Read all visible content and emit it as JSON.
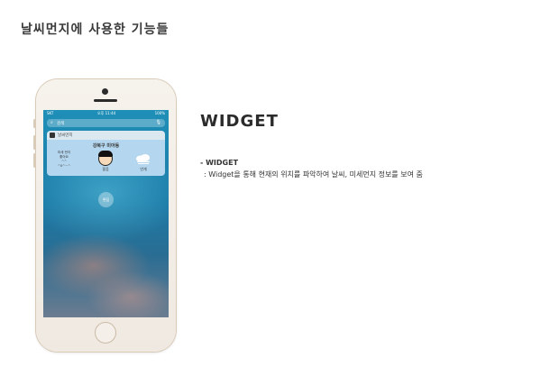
{
  "slide": {
    "title": "날씨먼지에 사용한 기능들"
  },
  "phone": {
    "status": {
      "carrier": "SKT",
      "time": "오후 11:44",
      "battery": "100%"
    },
    "search": {
      "placeholder": "검색"
    },
    "widget": {
      "app_name": "날씨먼지",
      "location": "강북구 미아동",
      "dust_lines": [
        "미세 먼지",
        "좋아요",
        "^^",
        "^0^~^"
      ],
      "grade_label": "좋음",
      "weather_label": "안개",
      "edit_label": "편집"
    }
  },
  "content": {
    "headline": "WIDGET",
    "sub_title": "- WIDGET",
    "description": ": Widget을 통해 현재의 위치를 파악하여 날씨, 미세먼지 정보를 보여 줌"
  }
}
